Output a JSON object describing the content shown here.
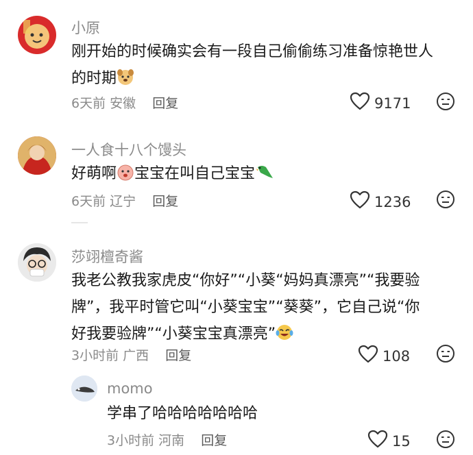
{
  "comments": [
    {
      "username": "小原",
      "text_line1": "刚开始的时候确实会有一段自己偷偷练习准备惊艳世人",
      "text_line2": "的时期",
      "time": "6天前",
      "location": "安徽",
      "reply": "回复",
      "likes": "9171",
      "emoji_1": "dog-face-emoji"
    },
    {
      "username": "一人食十八个馒头",
      "text_before": "好萌啊",
      "text_after": "宝宝在叫自己宝宝",
      "time": "6天前",
      "location": "辽宁",
      "reply": "回复",
      "likes": "1236",
      "emoji_1": "pink-face-emoji",
      "emoji_2": "parrot-emoji"
    },
    {
      "username": "莎翊檀奇酱",
      "text_line1": "我老公教我家虎皮“你好”“小葵“妈妈真漂亮”“我要验",
      "text_line2": "牌”，我平时管它叫“小葵宝宝”“葵葵”，它自己说“你",
      "text_line3": "好我要验牌”“小葵宝宝真漂亮”",
      "time": "3小时前",
      "location": "广西",
      "reply": "回复",
      "likes": "108",
      "emoji_1": "laughing-crying-emoji"
    },
    {
      "username": "momo",
      "text": "学串了哈哈哈哈哈哈哈",
      "time": "3小时前",
      "location": "河南",
      "reply": "回复",
      "likes": "15"
    }
  ],
  "icons": {
    "like": "heart-outline-icon",
    "dislike": "meh-face-icon"
  },
  "colors": {
    "username": "#8a8a8a",
    "text": "#1a1a1a",
    "meta": "#8a8a8a"
  }
}
